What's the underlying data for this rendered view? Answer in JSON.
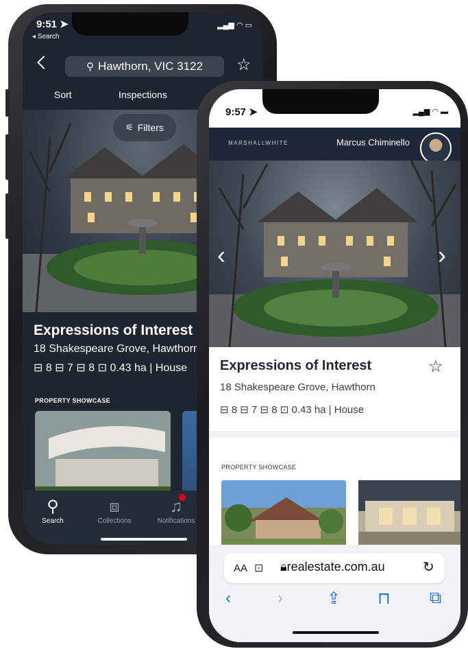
{
  "back_phone": {
    "status": {
      "time": "9:51",
      "back_link": "◂ Search"
    },
    "header": {
      "search_text": "Hawthorn, VIC 3122"
    },
    "toolbar": {
      "sort_label": "Sort",
      "inspections_label": "Inspections"
    },
    "filters_label": "Filters",
    "listing": {
      "title": "Expressions of Interest",
      "address": "18 Shakespeare Grove, Hawthorn",
      "features": "⊟ 8  ⊟ 7  ⊟ 8  ⊡ 0.43 ha  |  House"
    },
    "showcase_heading": "PROPERTY SHOWCASE",
    "tabs": [
      {
        "label": "Search",
        "icon": "search-icon"
      },
      {
        "label": "Collections",
        "icon": "collections-icon"
      },
      {
        "label": "Notifications",
        "icon": "bell-icon"
      }
    ]
  },
  "front_phone": {
    "status": {
      "time": "9:57"
    },
    "brand": "MARSHALLWHITE",
    "agent_name": "Marcus Chiminello",
    "listing": {
      "title": "Expressions of Interest",
      "address": "18 Shakespeare Grove, Hawthorn",
      "features": "⊟ 8   ⊟ 7   ⊟ 8   ⊡ 0.43 ha  |  House"
    },
    "showcase_heading": "PROPERTY SHOWCASE",
    "safari": {
      "text_size": "AA",
      "domain": "realestate.com.au"
    }
  },
  "colors": {
    "dark_bg": "#1f2530",
    "navy": "#1f2638",
    "notification_dot": "#e00019",
    "safari_link": "#1a73e8"
  }
}
